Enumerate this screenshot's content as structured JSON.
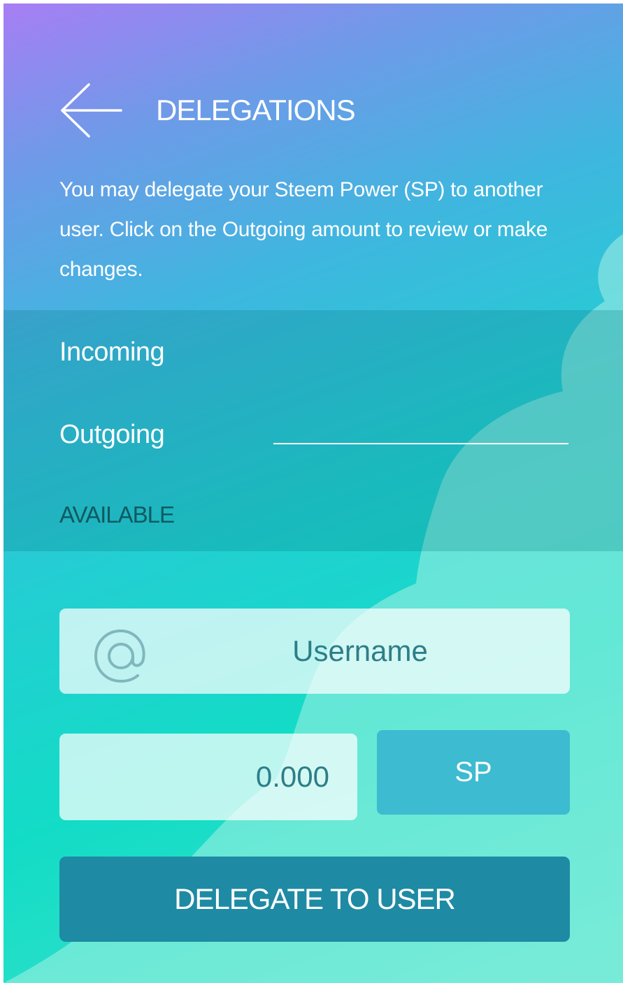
{
  "header": {
    "back_icon": "arrow-left-icon",
    "title": "DELEGATIONS"
  },
  "intro_text": "You may delegate your Steem Power (SP) to another user. Click on the Outgoing amount to review or make changes.",
  "summary": {
    "incoming_label": "Incoming",
    "outgoing_label": "Outgoing",
    "available_label": "AVAILABLE"
  },
  "form": {
    "username_icon": "at-sign-icon",
    "username_placeholder": "Username",
    "amount_placeholder": "0.000",
    "currency_label": "SP",
    "submit_label": "DELEGATE TO USER"
  },
  "colors": {
    "gradient_top": "#a77ef5",
    "gradient_mid": "#22cfd2",
    "gradient_bottom": "#3ee3cb",
    "blob": "#b4f3e6",
    "sp_button": "#3dbbd0",
    "delegate_button": "#1f8aa4",
    "available_text": "#0e5a62"
  }
}
